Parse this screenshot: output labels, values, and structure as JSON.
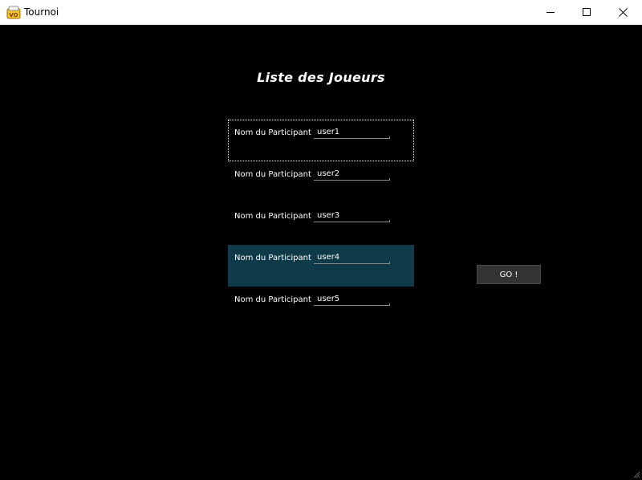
{
  "window": {
    "title": "Tournoi",
    "app_icon": "tournament-app-icon",
    "controls": [
      "minimize-icon",
      "maximize-icon",
      "close-icon"
    ]
  },
  "main": {
    "heading": "Liste des Joueurs",
    "participants": [
      {
        "label": "Nom du Participant",
        "value": "user1",
        "state": "focused"
      },
      {
        "label": "Nom du Participant",
        "value": "user2",
        "state": "normal"
      },
      {
        "label": "Nom du Participant",
        "value": "user3",
        "state": "normal"
      },
      {
        "label": "Nom du Participant",
        "value": "user4",
        "state": "selected"
      },
      {
        "label": "Nom du Participant",
        "value": "user5",
        "state": "normal"
      }
    ],
    "go_button": "GO !"
  },
  "colors": {
    "background": "#000000",
    "selected_row": "#0f3a4a",
    "button": "#333333",
    "text": "#ffffff"
  }
}
